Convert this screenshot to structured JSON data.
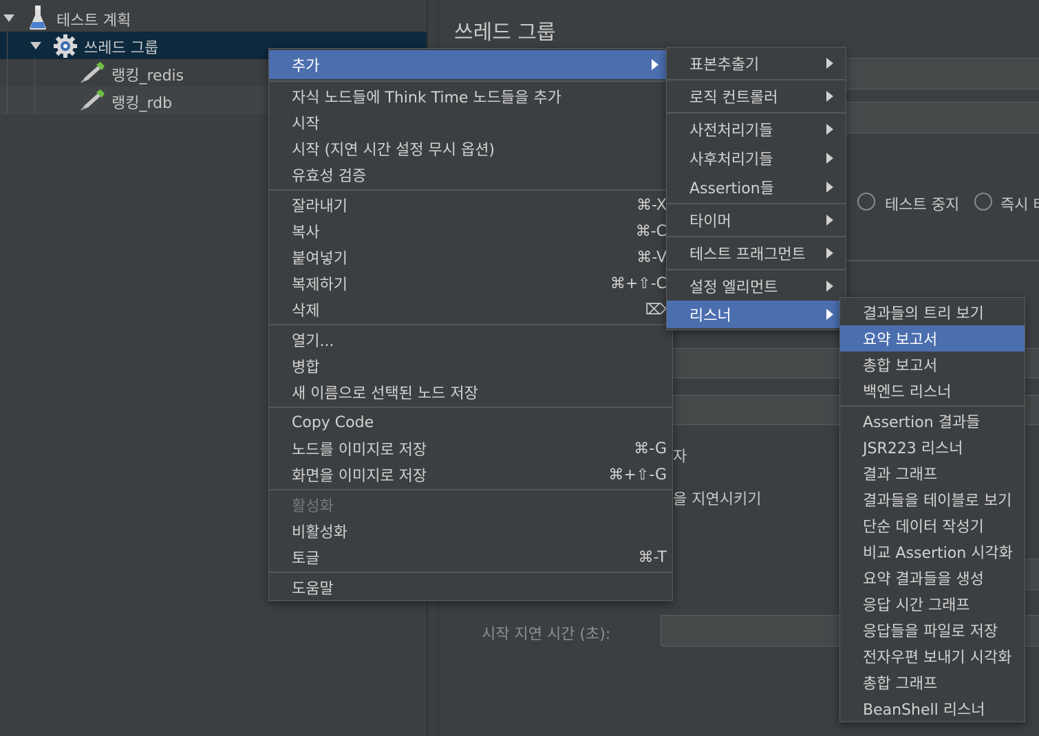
{
  "tree": {
    "items": [
      {
        "label": "테스트 계획"
      },
      {
        "label": "쓰레드 그룹"
      },
      {
        "label": "랭킹_redis"
      },
      {
        "label": "랭킹_rdb"
      }
    ]
  },
  "panel": {
    "title": "쓰레드 그룹",
    "radio_stop_test": "테스트 중지",
    "radio_stop_now": "즉시 테스트 중지",
    "partial_text_1": "자",
    "partial_text_2": "을 지연시키기",
    "startup_delay_label": "시작 지연 시간 (초):"
  },
  "context_menu": {
    "items": [
      {
        "label": "추가",
        "shortcut": ""
      },
      {
        "label": "자식 노드들에 Think Time 노드들을 추가",
        "shortcut": ""
      },
      {
        "label": "시작",
        "shortcut": ""
      },
      {
        "label": "시작 (지연 시간 설정 무시 옵션)",
        "shortcut": ""
      },
      {
        "label": "유효성 검증",
        "shortcut": ""
      },
      {
        "label": "잘라내기",
        "shortcut": "⌘-X"
      },
      {
        "label": "복사",
        "shortcut": "⌘-C"
      },
      {
        "label": "붙여넣기",
        "shortcut": "⌘-V"
      },
      {
        "label": "복제하기",
        "shortcut": "⌘+⇧-C"
      },
      {
        "label": "삭제",
        "shortcut": "⌦"
      },
      {
        "label": "열기...",
        "shortcut": ""
      },
      {
        "label": "병합",
        "shortcut": ""
      },
      {
        "label": "새 이름으로 선택된 노드 저장",
        "shortcut": ""
      },
      {
        "label": "Copy Code",
        "shortcut": ""
      },
      {
        "label": "노드를 이미지로 저장",
        "shortcut": "⌘-G"
      },
      {
        "label": "화면을 이미지로 저장",
        "shortcut": "⌘+⇧-G"
      },
      {
        "label": "활성화",
        "shortcut": ""
      },
      {
        "label": "비활성화",
        "shortcut": ""
      },
      {
        "label": "토글",
        "shortcut": "⌘-T"
      },
      {
        "label": "도움말",
        "shortcut": ""
      }
    ]
  },
  "add_submenu": {
    "items": [
      {
        "label": "표본추출기"
      },
      {
        "label": "로직 컨트롤러"
      },
      {
        "label": "사전처리기들"
      },
      {
        "label": "사후처리기들"
      },
      {
        "label": "Assertion들"
      },
      {
        "label": "타이머"
      },
      {
        "label": "테스트 프래그먼트"
      },
      {
        "label": "설정 엘리먼트"
      },
      {
        "label": "리스너"
      }
    ]
  },
  "listener_submenu": {
    "items": [
      {
        "label": "결과들의 트리 보기"
      },
      {
        "label": "요약 보고서"
      },
      {
        "label": "총합 보고서"
      },
      {
        "label": "백엔드 리스너"
      },
      {
        "label": "Assertion 결과들"
      },
      {
        "label": "JSR223 리스너"
      },
      {
        "label": "결과 그래프"
      },
      {
        "label": "결과들을 테이블로 보기"
      },
      {
        "label": "단순 데이터 작성기"
      },
      {
        "label": "비교 Assertion 시각화"
      },
      {
        "label": "요약 결과들을 생성"
      },
      {
        "label": "응답 시간 그래프"
      },
      {
        "label": "응답들을 파일로 저장"
      },
      {
        "label": "전자우편 보내기 시각화"
      },
      {
        "label": "총합 그래프"
      },
      {
        "label": "BeanShell 리스너"
      }
    ]
  },
  "colors": {
    "highlight": "#4b6eaf",
    "background": "#3c3f41",
    "tree_selected": "#0d293e"
  }
}
